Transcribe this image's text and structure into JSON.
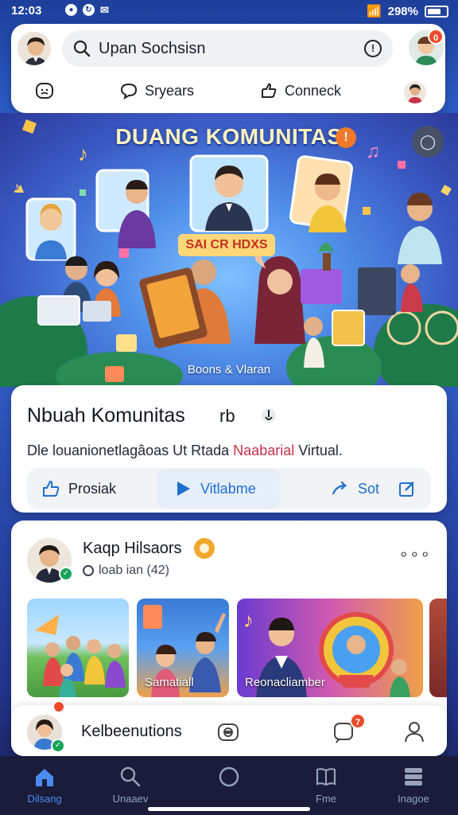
{
  "status_bar": {
    "time": "12:03",
    "battery": "298%"
  },
  "header": {
    "search_text": "Upan Sochsisn",
    "notification_count": "0",
    "nav": {
      "item1": "Sryears",
      "item2": "Conneck"
    }
  },
  "hero": {
    "title": "DUANG KOMUNITAS",
    "banner": "SAI CR HDXS",
    "caption": "Boons & Vlaran"
  },
  "community_card": {
    "title": "Nbuah Komunitas",
    "title_mark": "rb",
    "desc_part1": "Dle louanionetlagâoas  Ut Rtada ",
    "desc_accent": "Naabarial",
    "desc_part2": " Virtual.",
    "actions": {
      "first": "Prosiak",
      "video": "Vitlabme",
      "send": "Sot"
    }
  },
  "post": {
    "author": "Kaqp Hilsaors",
    "meta": "loab ian (42)",
    "thumbs": [
      {
        "label": ""
      },
      {
        "label": "Samatiall"
      },
      {
        "label": "Reonacliamber"
      },
      {
        "label": ""
      }
    ]
  },
  "comment_bar": {
    "label": "Kelbeenutions",
    "notification_count": "7"
  },
  "bottom_nav": [
    {
      "label": "Dilsang",
      "icon": "home-icon",
      "active": true
    },
    {
      "label": "Unaaev",
      "icon": "search-icon",
      "active": false
    },
    {
      "label": "",
      "icon": "circle-icon",
      "active": false
    },
    {
      "label": "Fme",
      "icon": "book-icon",
      "active": false
    },
    {
      "label": "Inagoe",
      "icon": "grid-icon",
      "active": false
    }
  ],
  "colors": {
    "accent": "#1f6fd0",
    "badge": "#ee4a2a",
    "nav_bg": "#1a1c3a"
  }
}
